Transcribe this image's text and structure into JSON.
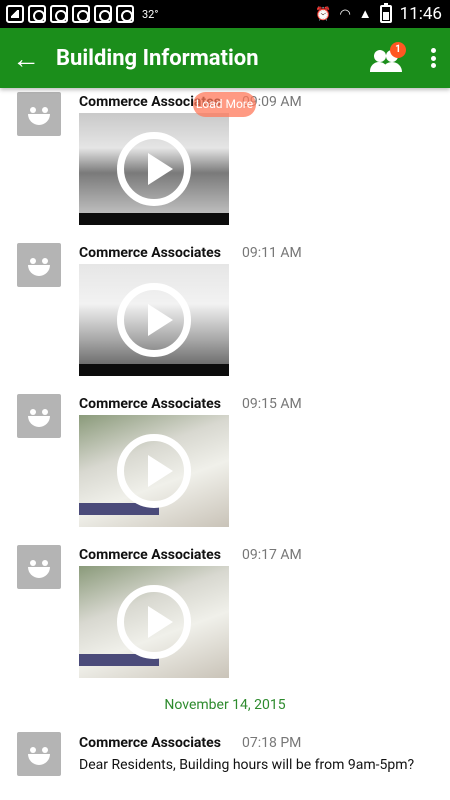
{
  "status_bar": {
    "temperature": "32°",
    "time": "11:46",
    "icons": [
      "image-icon",
      "notification-icon",
      "notification-icon",
      "notification-icon",
      "notification-icon",
      "notification-icon",
      "alarm-icon",
      "wifi-icon",
      "signal-icon",
      "battery-icon"
    ]
  },
  "app_bar": {
    "title": "Building Information",
    "back_icon": "arrow-back-icon",
    "members_badge": "1",
    "overflow_icon": "more-vert-icon"
  },
  "load_more": "Load More",
  "messages": [
    {
      "sender": "Commerce Associates",
      "time": "09:09 AM",
      "type": "video"
    },
    {
      "sender": "Commerce Associates",
      "time": "09:11 AM",
      "type": "video"
    },
    {
      "sender": "Commerce Associates",
      "time": "09:15 AM",
      "type": "video"
    },
    {
      "sender": "Commerce Associates",
      "time": "09:17 AM",
      "type": "video"
    }
  ],
  "date_separator": "November 14, 2015",
  "text_message": {
    "sender": "Commerce Associates",
    "time": "07:18 PM",
    "text": "Dear Residents, Building hours will be from 9am-5pm?"
  },
  "colors": {
    "app_bar": "#1b8e1b",
    "date_separator": "#2e8b2e",
    "badge": "#ff5722",
    "avatar": "#b4b4b4"
  }
}
